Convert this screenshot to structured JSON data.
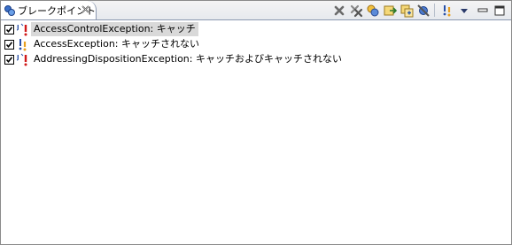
{
  "view": {
    "tab_label": "ブレークポイント",
    "tab_icon": "breakpoints-icon",
    "close_icon": "close-tab-icon"
  },
  "toolbar": {
    "icons": [
      "remove-selected-breakpoints-icon",
      "remove-all-breakpoints-icon",
      "show-supported-breakpoints-icon",
      "go-to-file-icon",
      "expand-all-icon",
      "skip-all-breakpoints-icon",
      "add-java-exception-breakpoint-icon",
      "view-menu-icon",
      "minimize-icon",
      "maximize-icon"
    ]
  },
  "breakpoints": [
    {
      "label": "AccessControlException: キャッチ",
      "checked": true,
      "selected": true,
      "icon": "exception-caught-icon"
    },
    {
      "label": "AccessException: キャッチされない",
      "checked": true,
      "selected": false,
      "icon": "exception-uncaught-icon"
    },
    {
      "label": "AddressingDispositionException: キャッチおよびキャッチされない",
      "checked": true,
      "selected": false,
      "icon": "exception-caught-uncaught-icon"
    }
  ],
  "colors": {
    "exception_red": "#d01818",
    "java_blue": "#2850a8",
    "java_orange": "#e8a020",
    "selection": "#d9d9d9"
  }
}
